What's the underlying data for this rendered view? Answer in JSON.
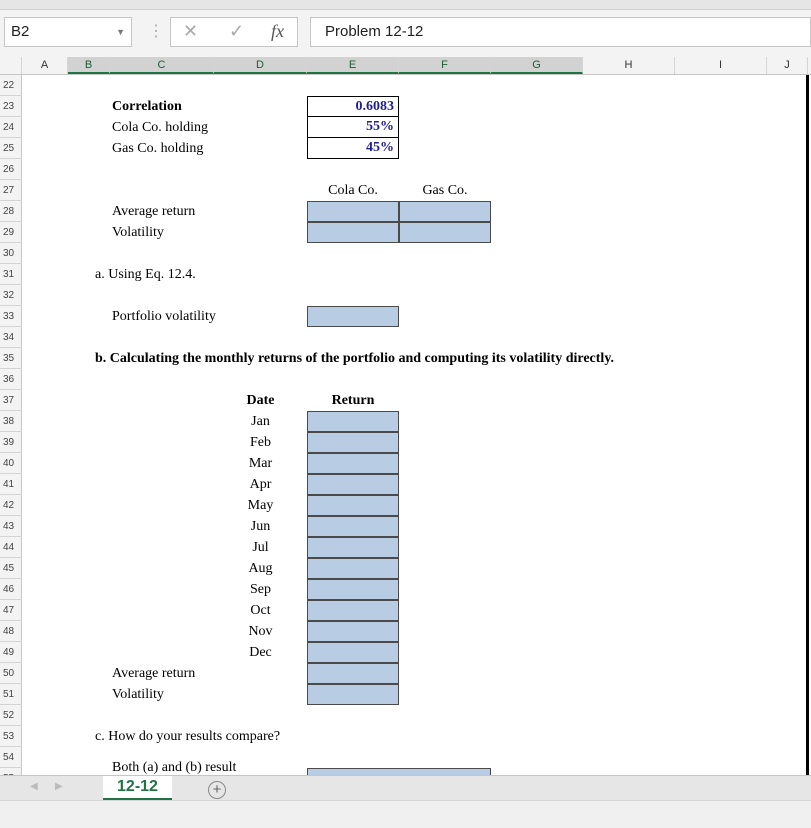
{
  "name_box": "B2",
  "formula_bar": {
    "cancel": "✕",
    "enter": "✓",
    "fx": "fx",
    "content": "Problem 12-12"
  },
  "columns": [
    "A",
    "B",
    "C",
    "D",
    "E",
    "F",
    "G",
    "H",
    "I",
    "J"
  ],
  "rows": [
    "22",
    "23",
    "24",
    "25",
    "26",
    "27",
    "28",
    "29",
    "30",
    "31",
    "32",
    "33",
    "34",
    "35",
    "36",
    "37",
    "38",
    "39",
    "40",
    "41",
    "42",
    "43",
    "44",
    "45",
    "46",
    "47",
    "48",
    "49",
    "50",
    "51",
    "52",
    "53",
    "54",
    "55"
  ],
  "inputs": {
    "correlation_label": "Correlation",
    "correlation": "0.6083",
    "cola_holding_label": "Cola Co. holding",
    "cola_holding": "55%",
    "gas_holding_label": "Gas Co. holding",
    "gas_holding": "45%"
  },
  "stats": {
    "cola_header": "Cola Co.",
    "gas_header": "Gas Co.",
    "avg_label": "Average return",
    "vol_label": "Volatility"
  },
  "part_a": {
    "title": "a. Using Eq. 12.4.",
    "label": "Portfolio volatility"
  },
  "part_b": {
    "title": "b. Calculating the monthly returns of the portfolio and computing its volatility directly.",
    "date_header": "Date",
    "return_header": "Return",
    "months": [
      "Jan",
      "Feb",
      "Mar",
      "Apr",
      "May",
      "Jun",
      "Jul",
      "Aug",
      "Sep",
      "Oct",
      "Nov",
      "Dec"
    ],
    "avg_label": "Average return",
    "vol_label": "Volatility"
  },
  "part_c": {
    "title": "c. How do your results compare?",
    "answer_label": "Both (a) and (b) result"
  },
  "sheet_tab": "12-12",
  "add_sheet": "+",
  "colors": {
    "input_fill": "#b8cce4",
    "value_text": "#1f1f8f",
    "excel_green": "#217346"
  }
}
